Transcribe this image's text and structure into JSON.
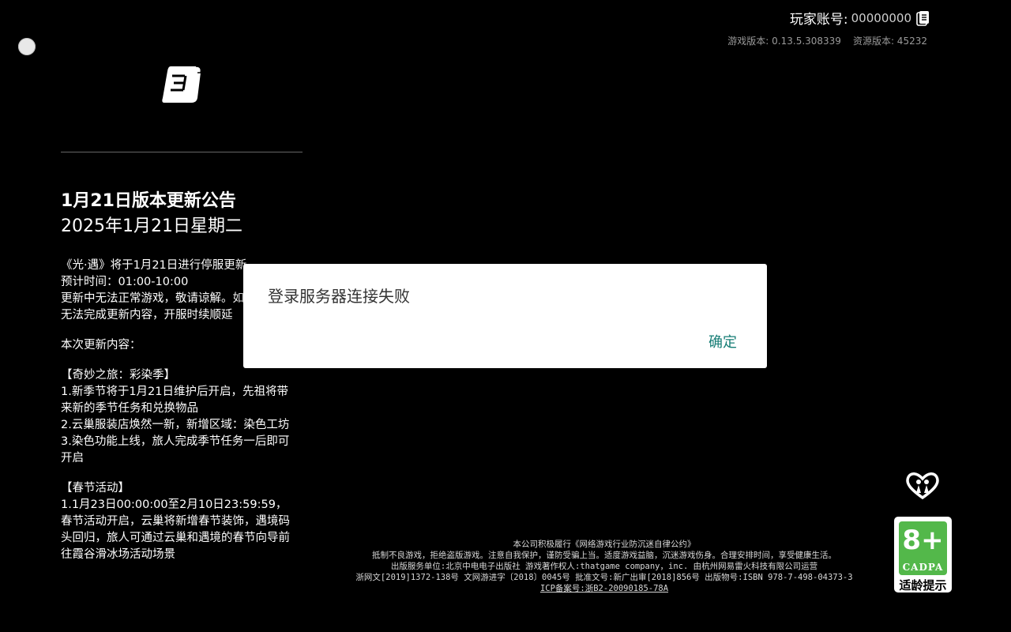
{
  "account": {
    "label": "玩家账号:",
    "value": "00000000"
  },
  "versions": {
    "game": "游戏版本: 0.13.5.308339",
    "resource": "资源版本: 45232"
  },
  "notice": {
    "title": "1月21日版本更新公告",
    "date": "2025年1月21日星期二",
    "lines": [
      "《光·遇》将于1月21日进行停服更新",
      "预计时间：01:00-10:00",
      "更新中无法正常游戏，敬请谅解。如计时间内无法完成更新内容，开服时续顺延",
      "",
      "本次更新内容：",
      "",
      "【奇妙之旅：彩染季】",
      "1.新季节将于1月21日维护后开启，先祖将带来新的季节任务和兑换物品",
      "2.云巢服装店焕然一新，新增区域：染色工坊",
      "3.染色功能上线，旅人完成季节任务一后即可开启",
      "",
      "【春节活动】",
      "1.1月23日00:00:00至2月10日23:59:59，春节活动开启，云巢将新增春节装饰，遇境码头回归，旅人可通过云巢和遇境的春节向导前往霞谷滑冰场活动场景"
    ]
  },
  "dialog": {
    "message": "登录服务器连接失败",
    "confirm_label": "确定"
  },
  "footer": {
    "lines": [
      "本公司积极履行《网络游戏行业防沉迷自律公约》",
      "抵制不良游戏，拒绝盗版游戏。注意自我保护，谨防受骗上当。适度游戏益脑，沉迷游戏伤身。合理安排时间，享受健康生活。",
      "出版服务单位:北京中电电子出版社 游戏著作权人:thatgame company，inc. 由杭州网易雷火科技有限公司运营",
      "浙网文[2019]1372-138号 文网游进字〔2018〕0045号 批准文号:新广出审[2018]856号 出版物号:ISBN 978-7-498-04373-3"
    ],
    "icp": "ICP备案号:浙B2-20090185-78A"
  },
  "age_badge": {
    "rating": "8+",
    "org": "CADPA",
    "caption": "适龄提示"
  },
  "colors": {
    "accent": "#167d75",
    "badge_green": "#53b84a"
  }
}
